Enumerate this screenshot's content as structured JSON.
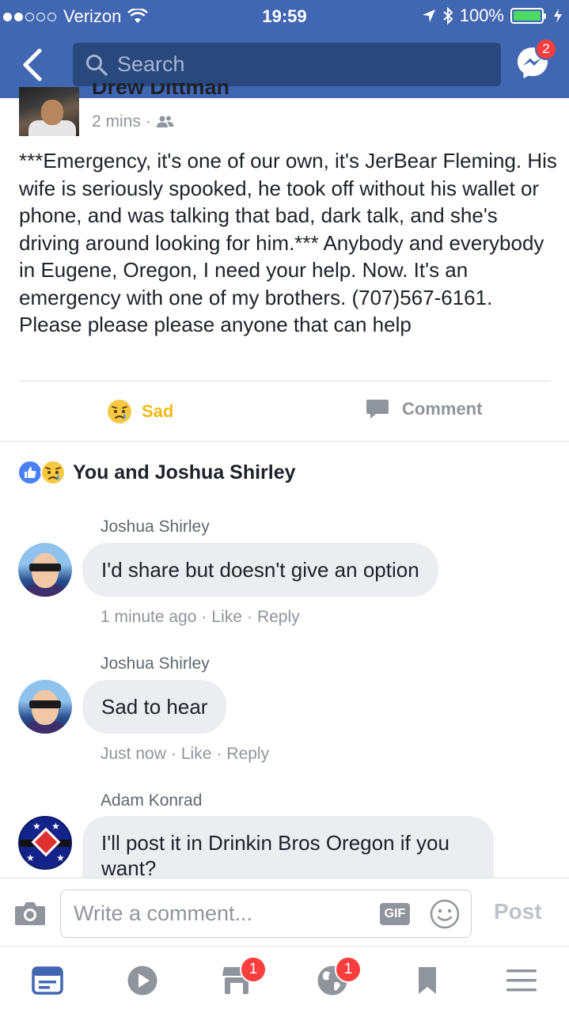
{
  "status_bar": {
    "carrier": "Verizon",
    "time": "19:59",
    "battery": "100%",
    "icons": [
      "signal-dots-icon",
      "wifi-icon",
      "location-arrow-icon",
      "bluetooth-icon",
      "battery-icon",
      "charging-bolt-icon"
    ]
  },
  "header": {
    "search_placeholder": "Search",
    "messenger_badge": "2",
    "icons": [
      "back-icon",
      "search-icon",
      "messenger-icon"
    ]
  },
  "post": {
    "author": "Drew Dittman",
    "time": "2 mins",
    "separator": "·",
    "audience_icon": "friends-icon",
    "text": "***Emergency, it's one of our own, it's JerBear Fleming. His wife is seriously spooked, he took off without his wallet or phone, and was talking that bad, dark talk, and she's driving around looking for him.*** Anybody and everybody in Eugene, Oregon, I need your help. Now. It's an emergency with one of my brothers. (707)567-6161. Please please please anyone that can help",
    "actions": {
      "reaction_label": "Sad",
      "comment_label": "Comment"
    }
  },
  "reactions": {
    "summary": "You and Joshua Shirley",
    "icons": [
      "like-reaction-icon",
      "sad-reaction-icon"
    ]
  },
  "comments": [
    {
      "name": "Joshua Shirley",
      "text": "I'd share but doesn't give an option",
      "time": "1 minute ago",
      "like": "Like",
      "reply": "Reply"
    },
    {
      "name": "Joshua Shirley",
      "text": "Sad to hear",
      "time": "Just now",
      "like": "Like",
      "reply": "Reply"
    },
    {
      "name": "Adam Konrad",
      "text": "I'll post it in Drinkin Bros Oregon if you want?"
    }
  ],
  "meta_separator": "·",
  "composer": {
    "placeholder": "Write a comment...",
    "gif_label": "GIF",
    "post_label": "Post"
  },
  "tab_bar": {
    "tabs": [
      {
        "name": "news-feed",
        "icon": "news-feed-icon",
        "badge": ""
      },
      {
        "name": "video",
        "icon": "video-play-icon",
        "badge": ""
      },
      {
        "name": "marketplace",
        "icon": "marketplace-icon",
        "badge": "1"
      },
      {
        "name": "notifications",
        "icon": "globe-icon",
        "badge": "1"
      },
      {
        "name": "saved",
        "icon": "bookmark-icon",
        "badge": ""
      },
      {
        "name": "menu",
        "icon": "hamburger-menu-icon",
        "badge": ""
      }
    ]
  },
  "colors": {
    "brand": "#4267b2",
    "sad": "#f0ba15",
    "badge": "#fa3e3e",
    "muted": "#90949c"
  }
}
